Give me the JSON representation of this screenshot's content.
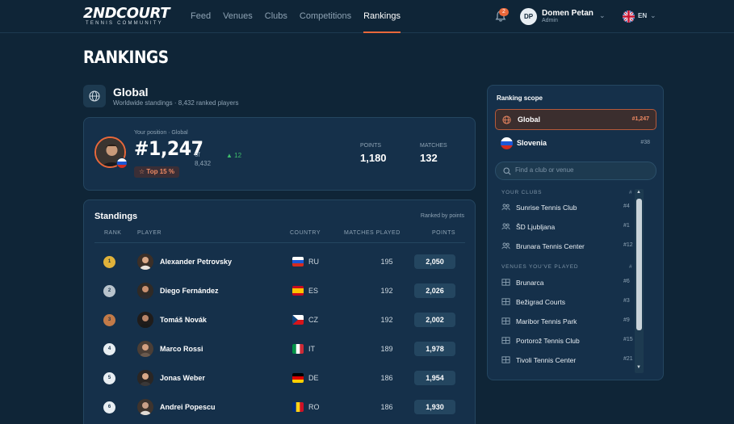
{
  "brand": {
    "name": "2NDCOURT",
    "tagline": "TENNIS COMMUNITY"
  },
  "nav": {
    "items": [
      "Feed",
      "Venues",
      "Clubs",
      "Competitions",
      "Rankings"
    ],
    "active": "Rankings"
  },
  "header": {
    "notification_count": "2",
    "user_initials": "DP",
    "user_name": "Domen Petan",
    "user_role": "Admin",
    "language": "EN"
  },
  "page": {
    "title": "RANKINGS"
  },
  "scope": {
    "title": "Global",
    "subtitle": "Worldwide standings · 8,432 ranked players"
  },
  "position": {
    "label": "Your position · Global",
    "rank": "#1,247",
    "of_label": "of",
    "of_total": "8,432",
    "delta": "12",
    "top_badge": "Top 15 %",
    "points_label": "POINTS",
    "points": "1,180",
    "matches_label": "MATCHES",
    "matches": "132"
  },
  "standings": {
    "title": "Standings",
    "note": "Ranked by points",
    "columns": [
      "RANK",
      "PLAYER",
      "COUNTRY",
      "MATCHES PLAYED",
      "POINTS"
    ],
    "rows": [
      {
        "rank": "1",
        "name": "Alexander Petrovsky",
        "country": "RU",
        "matches": "195",
        "points": "2,050"
      },
      {
        "rank": "2",
        "name": "Diego Fernández",
        "country": "ES",
        "matches": "192",
        "points": "2,026"
      },
      {
        "rank": "3",
        "name": "Tomáš Novák",
        "country": "CZ",
        "matches": "192",
        "points": "2,002"
      },
      {
        "rank": "4",
        "name": "Marco Rossi",
        "country": "IT",
        "matches": "189",
        "points": "1,978"
      },
      {
        "rank": "5",
        "name": "Jonas Weber",
        "country": "DE",
        "matches": "186",
        "points": "1,954"
      },
      {
        "rank": "6",
        "name": "Andrei Popescu",
        "country": "RO",
        "matches": "186",
        "points": "1,930"
      }
    ]
  },
  "sidebar": {
    "title": "Ranking scope",
    "options": [
      {
        "name": "Global",
        "rank": "#1,247"
      },
      {
        "name": "Slovenia",
        "rank": "#38"
      }
    ],
    "search_placeholder": "Find a club or venue",
    "clubs_heading": "YOUR CLUBS",
    "clubs_rank_hint": "#",
    "clubs": [
      {
        "name": "Sunrise Tennis Club",
        "rank": "#4"
      },
      {
        "name": "ŠD Ljubljana",
        "rank": "#1"
      },
      {
        "name": "Brunara Tennis Center",
        "rank": "#12"
      }
    ],
    "venues_heading": "VENUES YOU'VE PLAYED",
    "venues_rank_hint": "#",
    "venues": [
      {
        "name": "Brunarca",
        "rank": "#6"
      },
      {
        "name": "Bežigrad Courts",
        "rank": "#3"
      },
      {
        "name": "Maribor Tennis Park",
        "rank": "#9"
      },
      {
        "name": "Portorož Tennis Club",
        "rank": "#15"
      },
      {
        "name": "Tivoli Tennis Center",
        "rank": "#21"
      }
    ]
  },
  "colors": {
    "accent": "#e9683b",
    "background": "#0f2537",
    "card": "#15304a",
    "positive": "#3fbf6b"
  }
}
